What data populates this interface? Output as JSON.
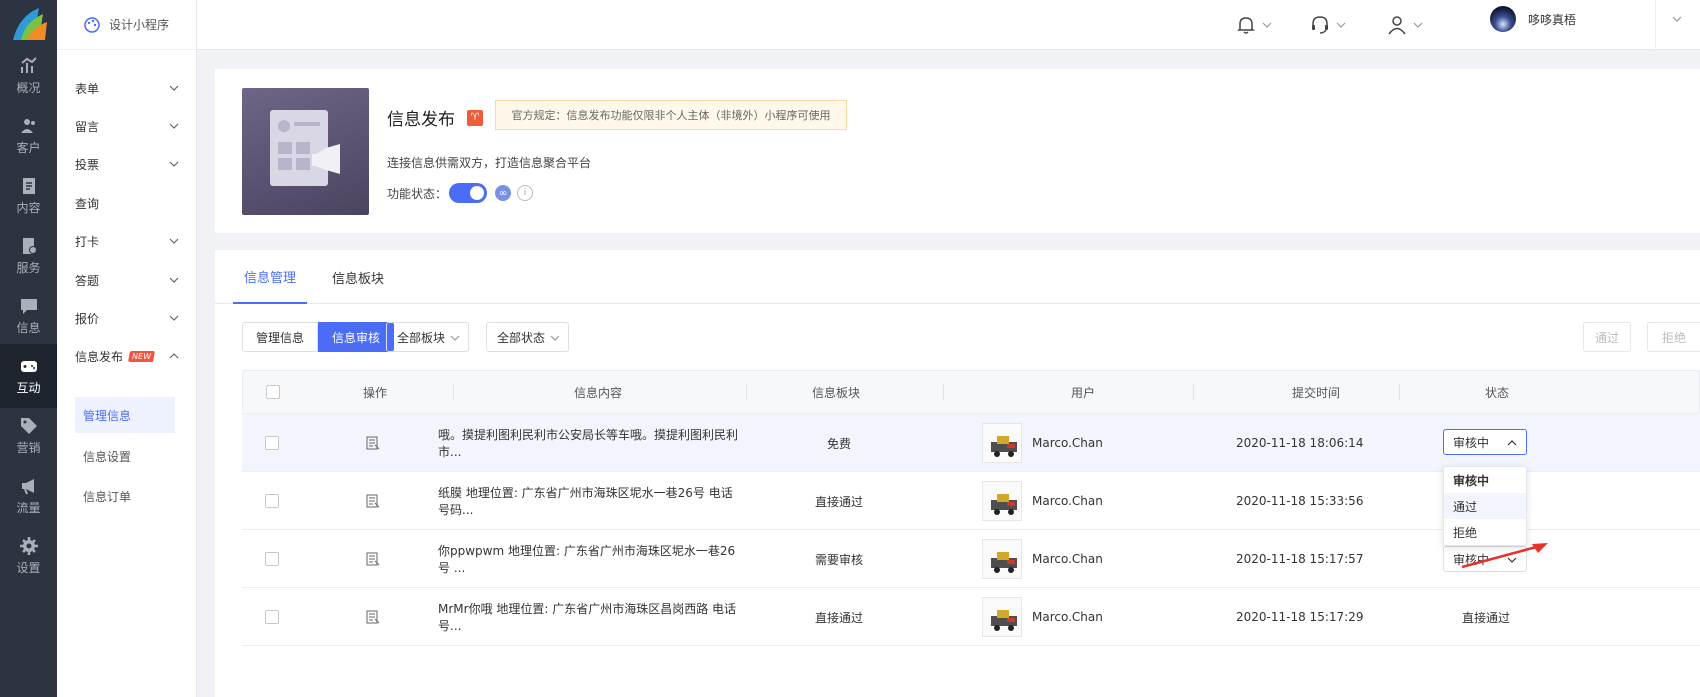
{
  "rail": {
    "items": [
      {
        "label": "概况",
        "icon": "chart-icon"
      },
      {
        "label": "客户",
        "icon": "users-icon"
      },
      {
        "label": "内容",
        "icon": "document-icon"
      },
      {
        "label": "服务",
        "icon": "service-icon"
      },
      {
        "label": "信息",
        "icon": "message-icon"
      },
      {
        "label": "互动",
        "icon": "gamepad-icon"
      },
      {
        "label": "营销",
        "icon": "tag-icon"
      },
      {
        "label": "流量",
        "icon": "megaphone-icon"
      },
      {
        "label": "设置",
        "icon": "gear-icon"
      }
    ],
    "active_index": 5
  },
  "menu": {
    "head": "设计小程序",
    "items": [
      {
        "label": "表单"
      },
      {
        "label": "留言"
      },
      {
        "label": "投票"
      },
      {
        "label": "查询"
      },
      {
        "label": "打卡"
      },
      {
        "label": "答题"
      },
      {
        "label": "报价"
      },
      {
        "label": "信息发布",
        "badge": "NEW"
      }
    ],
    "sub_items": [
      {
        "label": "管理信息"
      },
      {
        "label": "信息设置"
      },
      {
        "label": "信息订单"
      }
    ]
  },
  "topbar": {
    "user_name": "哆哆真梧"
  },
  "info": {
    "title": "信息发布",
    "notice": "官方规定：信息发布功能仅限非个人主体（非境外）小程序可使用",
    "desc": "连接信息供需双方，打造信息聚合平台",
    "status_label": "功能状态："
  },
  "tabs": [
    "信息管理",
    "信息板块"
  ],
  "filters": {
    "seg_manage": "管理信息",
    "seg_review": "信息审核",
    "board_select": "全部板块",
    "status_select": "全部状态",
    "approve_btn": "通过",
    "reject_btn": "拒绝"
  },
  "table": {
    "headers": [
      "操作",
      "信息内容",
      "信息板块",
      "用户",
      "提交时间",
      "状态"
    ],
    "rows": [
      {
        "content": "哦。摸提利图利民利市公安局长等车哦。摸提利图利民利市...",
        "board": "免费",
        "user": "Marco.Chan",
        "time": "2020-11-18 18:06:14",
        "status": "审核中",
        "status_type": "select-open"
      },
      {
        "content": "纸膜 地理位置: 广东省广州市海珠区坭水一巷26号 电话号码...",
        "board": "直接通过",
        "user": "Marco.Chan",
        "time": "2020-11-18 15:33:56",
        "status": "",
        "status_type": "none"
      },
      {
        "content": "你ppwpwm 地理位置: 广东省广州市海珠区坭水一巷26号 ...",
        "board": "需要审核",
        "user": "Marco.Chan",
        "time": "2020-11-18 15:17:57",
        "status": "审核中",
        "status_type": "select"
      },
      {
        "content": "MrMr你哦 地理位置: 广东省广州市海珠区昌岗西路 电话号...",
        "board": "直接通过",
        "user": "Marco.Chan",
        "time": "2020-11-18 15:17:29",
        "status": "直接通过",
        "status_type": "text"
      }
    ]
  },
  "status_dropdown": {
    "options": [
      "审核中",
      "通过",
      "拒绝"
    ]
  }
}
